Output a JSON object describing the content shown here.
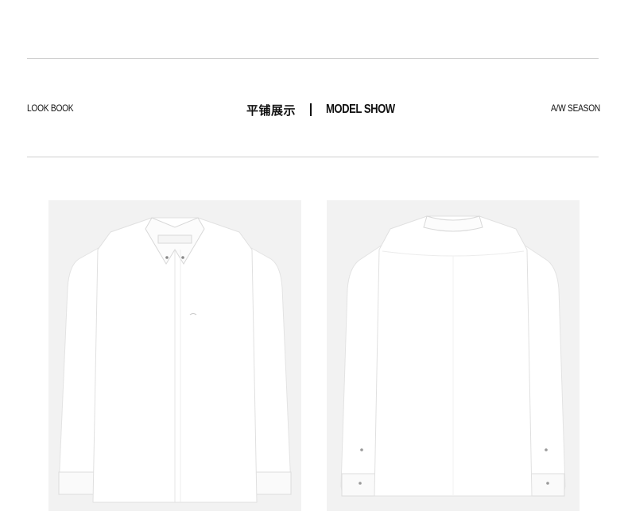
{
  "header": {
    "left_label": "LOOK BOOK",
    "center_cn": "平铺展示",
    "center_en": "MODEL SHOW",
    "right_label": "A/W SEASON"
  },
  "gallery": {
    "items": [
      {
        "view": "front",
        "icon": "shirt-front-image"
      },
      {
        "view": "back",
        "icon": "shirt-back-image"
      }
    ]
  },
  "colors": {
    "background": "#ffffff",
    "photo_bg": "#f2f2f2",
    "shirt": "#ffffff",
    "rule": "#cfcfcf",
    "text": "#111111"
  }
}
